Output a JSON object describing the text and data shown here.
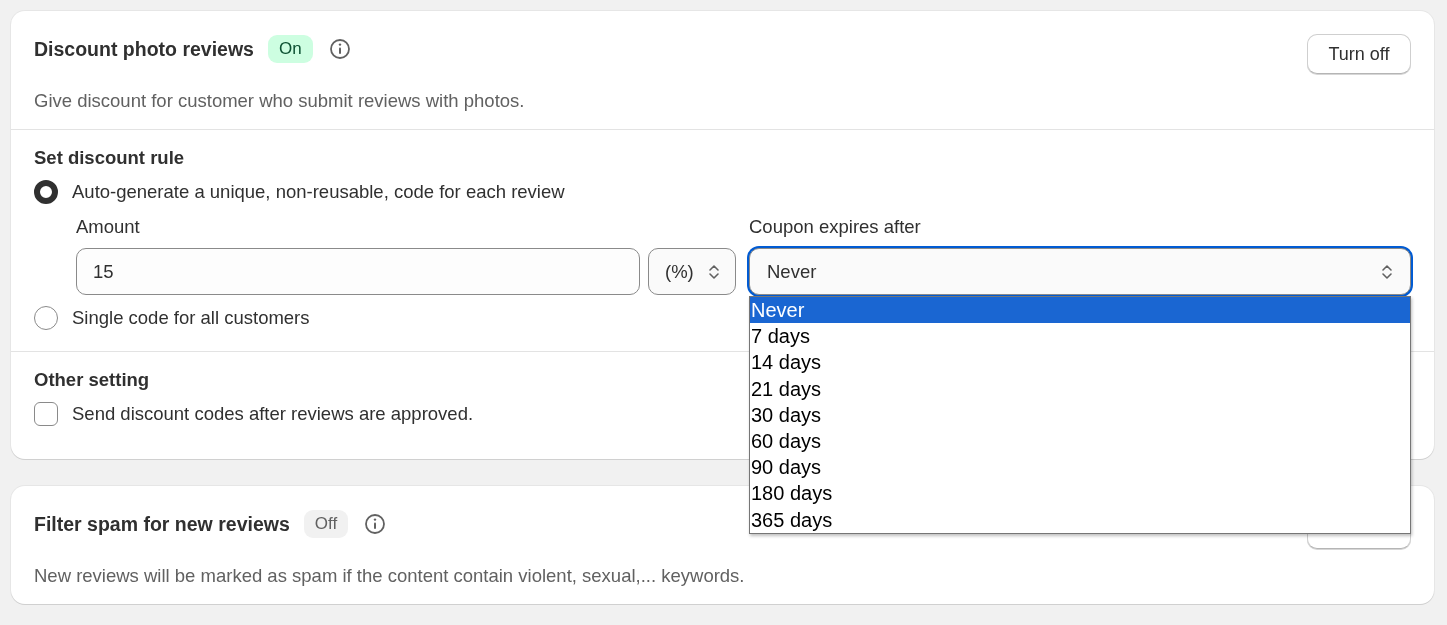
{
  "cards": [
    {
      "title": "Discount photo reviews",
      "status": {
        "label": "On",
        "on": true
      },
      "button": "Turn off",
      "description": "Give discount for customer who submit reviews with photos.",
      "sections": [
        {
          "heading": "Set discount rule",
          "options": [
            {
              "kind": "radio",
              "label": "Auto-generate a unique, non-reusable, code for each review",
              "selected": true,
              "fields": {
                "amount": {
                  "label": "Amount",
                  "value": "15",
                  "unit": "(%)"
                },
                "expiry": {
                  "label": "Coupon expires after",
                  "value": "Never",
                  "focused": true,
                  "dropdown": [
                    {
                      "label": "Never",
                      "selected": true
                    },
                    {
                      "label": "7 days",
                      "selected": false
                    },
                    {
                      "label": "14 days",
                      "selected": false
                    },
                    {
                      "label": "21 days",
                      "selected": false
                    },
                    {
                      "label": "30 days",
                      "selected": false
                    },
                    {
                      "label": "60 days",
                      "selected": false
                    },
                    {
                      "label": "90 days",
                      "selected": false
                    },
                    {
                      "label": "180 days",
                      "selected": false
                    },
                    {
                      "label": "365 days",
                      "selected": false
                    }
                  ]
                }
              }
            },
            {
              "kind": "radio",
              "label": "Single code for all customers",
              "selected": false
            }
          ]
        },
        {
          "heading": "Other setting",
          "options": [
            {
              "kind": "checkbox",
              "label": "Send discount codes after reviews are approved.",
              "checked": false
            }
          ]
        }
      ]
    },
    {
      "title": "Filter spam for new reviews",
      "status": {
        "label": "Off",
        "on": false
      },
      "description": "New reviews will be marked as spam if the content contain violent, sexual,... keywords."
    }
  ]
}
